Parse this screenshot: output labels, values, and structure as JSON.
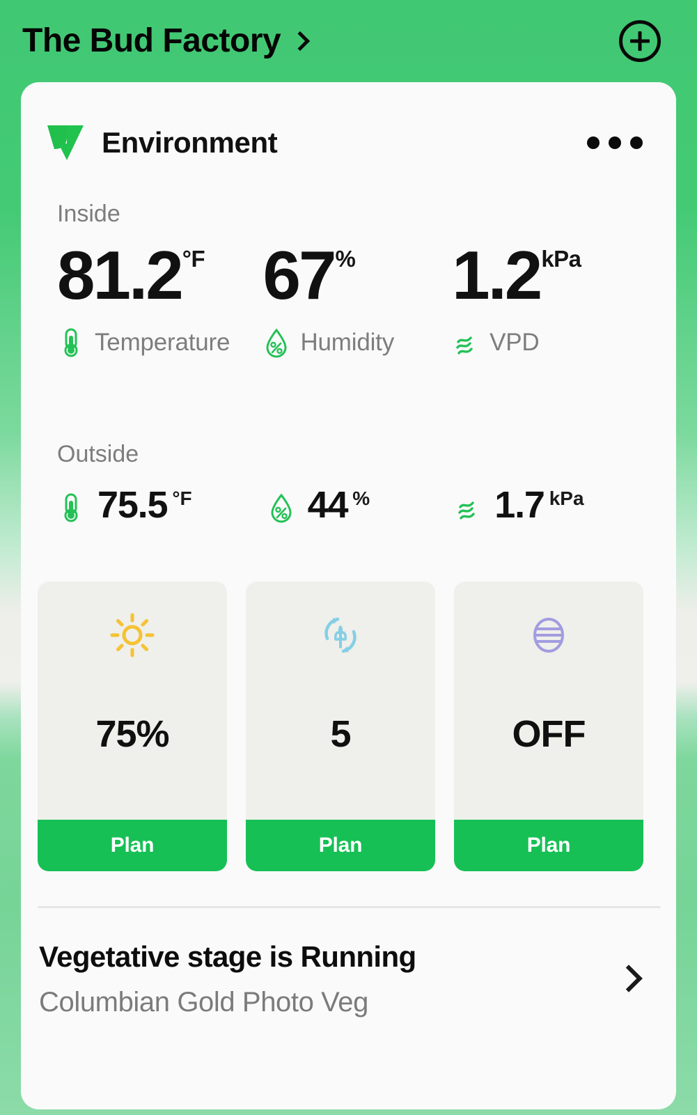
{
  "topbar": {
    "title": "The Bud Factory",
    "chevron_icon": "chevron-right-icon",
    "add_icon": "plus-circle-icon"
  },
  "card": {
    "logo_icon": "vivosun-v-leaf-logo",
    "title": "Environment",
    "menu_icon": "more-horizontal-icon",
    "inside": {
      "label": "Inside",
      "metrics": [
        {
          "value": "81.2",
          "unit": "°F",
          "name": "Temperature",
          "icon": "thermometer-icon"
        },
        {
          "value": "67",
          "unit": "%",
          "name": "Humidity",
          "icon": "humidity-droplet-icon"
        },
        {
          "value": "1.2",
          "unit": "kPa",
          "name": "VPD",
          "icon": "vpd-waves-icon"
        }
      ]
    },
    "outside": {
      "label": "Outside",
      "metrics": [
        {
          "value": "75.5",
          "unit": "°F",
          "icon": "thermometer-icon"
        },
        {
          "value": "44",
          "unit": "%",
          "icon": "humidity-droplet-icon"
        },
        {
          "value": "1.7",
          "unit": "kPa",
          "icon": "vpd-waves-icon"
        }
      ]
    },
    "tiles": [
      {
        "icon": "sun-icon",
        "value": "75%",
        "button_label": "Plan",
        "icon_color": "#f5c232"
      },
      {
        "icon": "circulation-leaf-icon",
        "value": "5",
        "button_label": "Plan",
        "icon_color": "#85cfe5"
      },
      {
        "icon": "dehumidifier-icon",
        "value": "OFF",
        "button_label": "Plan",
        "icon_color": "#a29de0"
      }
    ],
    "footer": {
      "title": "Vegetative stage is Running",
      "subtitle": "Columbian Gold Photo Veg",
      "chevron_icon": "chevron-right-icon"
    }
  },
  "colors": {
    "header_green": "#45c96f",
    "accent_green": "#16c055",
    "logo_green": "#21bf4b",
    "icon_green": "#24c156",
    "card_bg": "#fafafa",
    "tile_bg": "#efefeb",
    "muted_text": "#7d7d7d"
  }
}
